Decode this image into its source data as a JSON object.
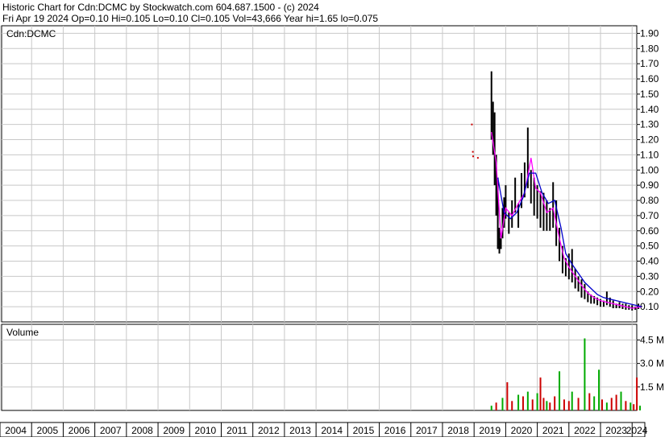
{
  "header": {
    "line1": "Historic Chart for Cdn:DCMC by Stockwatch.com 604.687.1500 - (c) 2024",
    "line2": "Fri Apr 19 2024   Op=0.10  Hi=0.105  Lo=0.10  Cl=0.105  Vol=43,666  Year hi=1.65  lo=0.075"
  },
  "colors": {
    "background": "#ffffff",
    "grid": "#c8c8c8",
    "price_bars": "#000000",
    "ma_short": "#ff00ff",
    "ma_long": "#0000cc",
    "volume_up": "#00aa00",
    "volume_down": "#cc0000",
    "marker": "#cc0000"
  },
  "chart_data": [
    {
      "type": "line",
      "title": "Cdn:DCMC",
      "symbol_label": "Cdn:DCMC",
      "ylim": [
        0,
        1.95
      ],
      "y_ticks": [
        "0.10",
        "0.20",
        "0.30",
        "0.40",
        "0.50",
        "0.60",
        "0.70",
        "0.80",
        "0.90",
        "1.00",
        "1.10",
        "1.20",
        "1.30",
        "1.40",
        "1.50",
        "1.60",
        "1.70",
        "1.80",
        "1.90"
      ],
      "x_ticks": [
        "2004",
        "2005",
        "2006",
        "2007",
        "2008",
        "2009",
        "2010",
        "2011",
        "2012",
        "2013",
        "2014",
        "2015",
        "2016",
        "2017",
        "2018",
        "2019",
        "2020",
        "2021",
        "2022",
        "2023",
        "2024"
      ],
      "xlim": [
        2004.0,
        2024.3
      ],
      "markers": [
        {
          "x": 2018.93,
          "y": 1.3
        },
        {
          "x": 2018.96,
          "y": 1.12
        },
        {
          "x": 2018.97,
          "y": 1.09
        },
        {
          "x": 2019.12,
          "y": 1.08
        }
      ],
      "series": [
        {
          "name": "",
          "kind": "price_range",
          "x": [
            2019.55,
            2019.6,
            2019.65,
            2019.7,
            2019.75,
            2019.8,
            2019.85,
            2019.9,
            2019.95,
            2020.0,
            2020.1,
            2020.2,
            2020.3,
            2020.4,
            2020.5,
            2020.6,
            2020.7,
            2020.8,
            2020.9,
            2021.0,
            2021.1,
            2021.2,
            2021.3,
            2021.4,
            2021.5,
            2021.6,
            2021.7,
            2021.8,
            2021.9,
            2022.0,
            2022.1,
            2022.2,
            2022.3,
            2022.4,
            2022.5,
            2022.6,
            2022.7,
            2022.8,
            2022.9,
            2023.0,
            2023.1,
            2023.2,
            2023.3,
            2023.4,
            2023.5,
            2023.6,
            2023.7,
            2023.8,
            2023.9,
            2024.0,
            2024.1,
            2024.2,
            2024.3
          ],
          "high": [
            1.65,
            1.45,
            1.38,
            1.1,
            0.95,
            0.62,
            0.55,
            0.75,
            0.82,
            0.9,
            0.72,
            0.8,
            0.95,
            0.78,
            0.98,
            1.05,
            1.28,
            1.0,
            0.95,
            0.9,
            0.86,
            0.85,
            0.8,
            0.75,
            0.92,
            0.8,
            0.62,
            0.5,
            0.42,
            0.45,
            0.48,
            0.35,
            0.3,
            0.28,
            0.25,
            0.2,
            0.18,
            0.17,
            0.16,
            0.15,
            0.14,
            0.2,
            0.16,
            0.14,
            0.12,
            0.13,
            0.12,
            0.12,
            0.11,
            0.11,
            0.1,
            0.12,
            0.105
          ],
          "low": [
            1.2,
            1.1,
            0.9,
            0.7,
            0.48,
            0.45,
            0.48,
            0.55,
            0.62,
            0.68,
            0.58,
            0.62,
            0.72,
            0.62,
            0.75,
            0.82,
            0.88,
            0.78,
            0.7,
            0.68,
            0.62,
            0.6,
            0.6,
            0.6,
            0.62,
            0.5,
            0.4,
            0.32,
            0.3,
            0.28,
            0.26,
            0.22,
            0.2,
            0.16,
            0.15,
            0.13,
            0.12,
            0.12,
            0.11,
            0.1,
            0.1,
            0.11,
            0.1,
            0.09,
            0.09,
            0.09,
            0.085,
            0.08,
            0.08,
            0.075,
            0.08,
            0.085,
            0.1
          ]
        },
        {
          "name": "",
          "kind": "ma_short",
          "x": [
            2019.55,
            2019.7,
            2019.85,
            2020.0,
            2020.2,
            2020.4,
            2020.6,
            2020.8,
            2020.95,
            2021.1,
            2021.3,
            2021.5,
            2021.7,
            2021.85,
            2022.0,
            2022.2,
            2022.4,
            2022.6,
            2022.8,
            2023.0,
            2023.2,
            2023.4,
            2023.6,
            2023.8,
            2024.0,
            2024.3
          ],
          "y": [
            1.25,
            1.05,
            0.55,
            0.75,
            0.7,
            0.78,
            0.85,
            1.08,
            0.88,
            0.85,
            0.72,
            0.75,
            0.55,
            0.42,
            0.36,
            0.3,
            0.24,
            0.19,
            0.16,
            0.14,
            0.13,
            0.12,
            0.11,
            0.1,
            0.09,
            0.1
          ]
        },
        {
          "name": "",
          "kind": "ma_long",
          "x": [
            2019.75,
            2019.95,
            2020.15,
            2020.35,
            2020.55,
            2020.75,
            2020.95,
            2021.15,
            2021.35,
            2021.55,
            2021.75,
            2021.9,
            2022.1,
            2022.3,
            2022.5,
            2022.7,
            2022.9,
            2023.1,
            2023.3,
            2023.5,
            2023.7,
            2023.9,
            2024.1,
            2024.3
          ],
          "y": [
            0.95,
            0.72,
            0.68,
            0.72,
            0.82,
            0.98,
            0.98,
            0.85,
            0.78,
            0.8,
            0.62,
            0.45,
            0.38,
            0.32,
            0.26,
            0.22,
            0.18,
            0.16,
            0.15,
            0.14,
            0.13,
            0.12,
            0.11,
            0.1
          ]
        }
      ]
    },
    {
      "type": "bar",
      "title": "Volume",
      "ylim": [
        0,
        5.5
      ],
      "y_ticks": [
        "1.5 M",
        "3.0 M",
        "4.5 M"
      ],
      "unit": "M",
      "xlim": [
        2004.0,
        2024.3
      ],
      "series": [
        {
          "name": "",
          "x": [
            2019.55,
            2019.7,
            2019.9,
            2020.05,
            2020.2,
            2020.4,
            2020.55,
            2020.7,
            2020.85,
            2021.0,
            2021.1,
            2021.2,
            2021.3,
            2021.4,
            2021.55,
            2021.7,
            2021.85,
            2022.0,
            2022.1,
            2022.3,
            2022.5,
            2022.65,
            2022.8,
            2022.95,
            2023.05,
            2023.2,
            2023.35,
            2023.5,
            2023.65,
            2023.8,
            2023.95,
            2024.05,
            2024.15,
            2024.25
          ],
          "values": [
            0.3,
            0.5,
            0.8,
            1.8,
            0.6,
            1.0,
            0.9,
            1.2,
            0.7,
            1.1,
            2.1,
            0.8,
            0.6,
            0.5,
            0.9,
            2.5,
            0.7,
            0.6,
            1.2,
            0.8,
            4.6,
            1.1,
            0.9,
            2.6,
            0.7,
            0.5,
            0.8,
            1.0,
            1.2,
            0.6,
            0.5,
            0.4,
            2.1,
            0.3
          ],
          "direction": [
            "up",
            "down",
            "up",
            "down",
            "down",
            "up",
            "down",
            "up",
            "down",
            "up",
            "down",
            "down",
            "up",
            "down",
            "down",
            "up",
            "down",
            "down",
            "up",
            "down",
            "up",
            "down",
            "up",
            "up",
            "down",
            "up",
            "down",
            "down",
            "up",
            "down",
            "up",
            "down",
            "down",
            "up"
          ]
        }
      ]
    }
  ]
}
